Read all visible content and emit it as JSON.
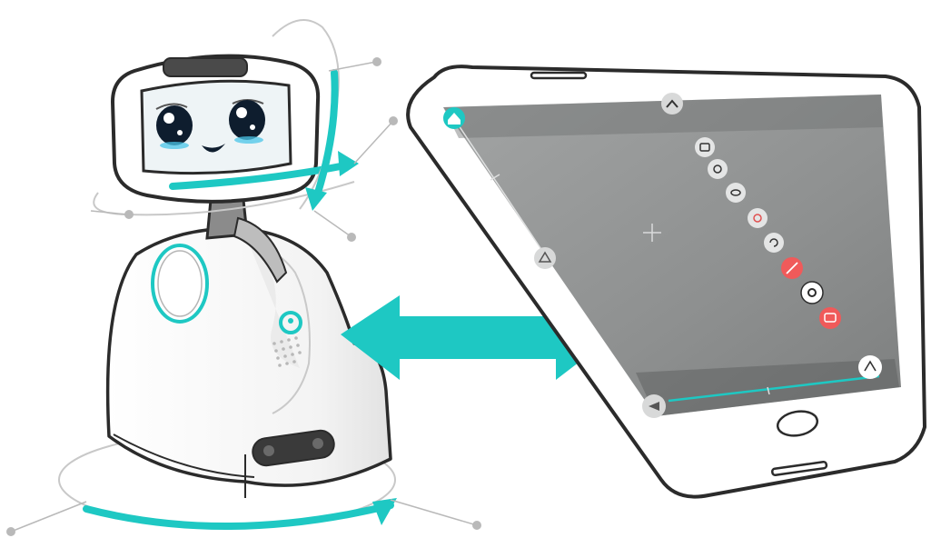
{
  "colors": {
    "accent": "#1ec8c3",
    "outline": "#2b2b2b",
    "guide": "#b9b9b9",
    "screen_bg": "#8f9191",
    "button_red": "#f05a5a",
    "phone_frame": "#ffffff",
    "robot_body": "#ffffff",
    "robot_shade": "#e9e9e9"
  },
  "robot": {
    "icons": [
      "robot-head",
      "robot-face",
      "robot-body",
      "robot-logo-icon",
      "robot-speaker-grille"
    ],
    "motions": [
      "head-yaw-rotation",
      "head-pitch-rotation",
      "base-rotation"
    ]
  },
  "connection": {
    "icon": "double-headed-arrow-icon"
  },
  "phone": {
    "screen_controls": [
      "home-icon",
      "collapse-chevron-icon",
      "camera-icon",
      "photo-icon",
      "eye-icon",
      "settings-icon",
      "refresh-icon",
      "mute-icon",
      "gear-robot-icon",
      "emotion-icon",
      "pitch-slider",
      "yaw-slider",
      "crosshair-icon",
      "joystick-icon",
      "tilt-reset-icon"
    ]
  }
}
